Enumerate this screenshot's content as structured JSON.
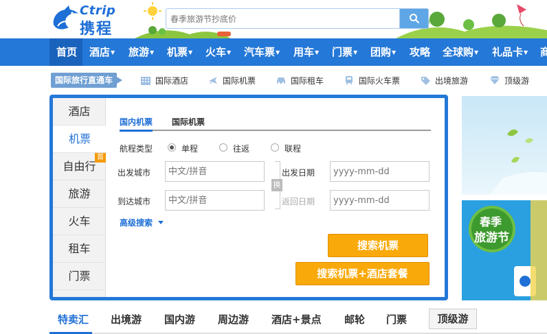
{
  "header": {
    "logo_en": "Ctrip",
    "logo_zh": "携程",
    "search_placeholder": "春季旅游节抄底价"
  },
  "nav": {
    "items": [
      {
        "label": "首页",
        "caret": false
      },
      {
        "label": "酒店",
        "caret": true
      },
      {
        "label": "旅游",
        "caret": true
      },
      {
        "label": "机票",
        "caret": true
      },
      {
        "label": "火车",
        "caret": true
      },
      {
        "label": "汽车票",
        "caret": true
      },
      {
        "label": "用车",
        "caret": true
      },
      {
        "label": "门票",
        "caret": true
      },
      {
        "label": "团购",
        "caret": true
      },
      {
        "label": "攻略",
        "caret": false
      },
      {
        "label": "全球购",
        "caret": true
      },
      {
        "label": "礼品卡",
        "caret": true
      },
      {
        "label": "商",
        "caret": false
      }
    ]
  },
  "quickbar": {
    "tag": "国际旅行直通车",
    "links": [
      {
        "label": "国际酒店",
        "icon": "building-icon"
      },
      {
        "label": "国际机票",
        "icon": "plane-icon"
      },
      {
        "label": "国际租车",
        "icon": "car-icon"
      },
      {
        "label": "国际火车票",
        "icon": "train-icon"
      },
      {
        "label": "出境旅游",
        "icon": "tag-icon"
      },
      {
        "label": "顶级游",
        "icon": "diamond-icon"
      }
    ]
  },
  "booking": {
    "side_tabs": [
      {
        "label": "酒店"
      },
      {
        "label": "机票"
      },
      {
        "label": "自由行",
        "badge": "首"
      },
      {
        "label": "旅游"
      },
      {
        "label": "火车"
      },
      {
        "label": "租车"
      },
      {
        "label": "门票"
      }
    ],
    "sub_tabs": [
      "国内机票",
      "国际机票"
    ],
    "trip_type_label": "航程类型",
    "trip_types": [
      "单程",
      "往返",
      "联程"
    ],
    "depart_city_label": "出发城市",
    "arrive_city_label": "到达城市",
    "city_placeholder": "中文/拼音",
    "swap_label": "换",
    "depart_date_label": "出发日期",
    "return_date_label": "返回日期",
    "date_placeholder": "yyyy-mm-dd",
    "advanced_label": "高级搜索",
    "search_button": "搜索机票",
    "package_button": "搜索机票+酒店套餐"
  },
  "banners": {
    "spring_badge_line1": "春季",
    "spring_badge_line2": "旅游节"
  },
  "bottom_tabs": [
    "特卖汇",
    "出境游",
    "国内游",
    "周边游",
    "酒店+景点",
    "邮轮",
    "门票"
  ],
  "bottom_tab_boxed": "顶级游",
  "colors": {
    "brand_blue": "#2478d7",
    "accent_orange": "#f9a90a"
  }
}
